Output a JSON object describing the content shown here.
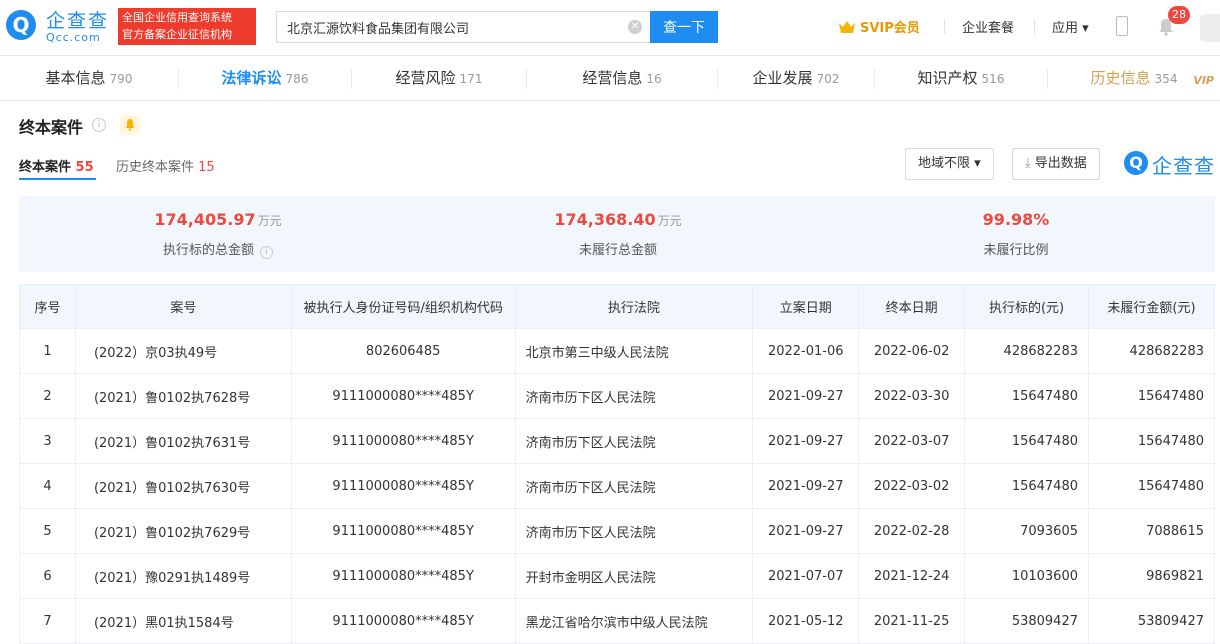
{
  "header": {
    "logo_text": "企查查",
    "logo_sub": "Qcc.com",
    "badge_line1": "全国企业信用查询系统",
    "badge_line2": "官方备案企业征信机构",
    "search_value": "北京汇源饮料食品集团有限公司",
    "search_button": "查一下",
    "svip": "SVIP会员",
    "nav_package": "企业套餐",
    "nav_apps": "应用 ▾",
    "notif_count": "28"
  },
  "tabs": [
    {
      "label": "基本信息",
      "count": "790"
    },
    {
      "label": "法律诉讼",
      "count": "786"
    },
    {
      "label": "经营风险",
      "count": "171"
    },
    {
      "label": "经营信息",
      "count": "16"
    },
    {
      "label": "企业发展",
      "count": "702"
    },
    {
      "label": "知识产权",
      "count": "516"
    },
    {
      "label": "历史信息",
      "count": "354",
      "tag": "VIP"
    }
  ],
  "section": {
    "title": "终本案件",
    "subtab_active_label": "终本案件",
    "subtab_active_count": "55",
    "subtab_other_label": "历史终本案件",
    "subtab_other_count": "15",
    "region_filter": "地域不限 ▾",
    "export_label": "导出数据",
    "brand_text": "企查查"
  },
  "summary": [
    {
      "value": "174,405.97",
      "unit": "万元",
      "label": "执行标的总金额"
    },
    {
      "value": "174,368.40",
      "unit": "万元",
      "label": "未履行总金额"
    },
    {
      "value": "99.98%",
      "unit": "",
      "label": "未履行比例"
    }
  ],
  "table": {
    "headers": [
      "序号",
      "案号",
      "被执行人身份证号码/组织机构代码",
      "执行法院",
      "立案日期",
      "终本日期",
      "执行标的(元)",
      "未履行金额(元)"
    ],
    "rows": [
      [
        "1",
        "(2022）京03执49号",
        "802606485",
        "北京市第三中级人民法院",
        "2022-01-06",
        "2022-06-02",
        "428682283",
        "428682283"
      ],
      [
        "2",
        "(2021）鲁0102执7628号",
        "9111000080****485Y",
        "济南市历下区人民法院",
        "2021-09-27",
        "2022-03-30",
        "15647480",
        "15647480"
      ],
      [
        "3",
        "(2021）鲁0102执7631号",
        "9111000080****485Y",
        "济南市历下区人民法院",
        "2021-09-27",
        "2022-03-07",
        "15647480",
        "15647480"
      ],
      [
        "4",
        "(2021）鲁0102执7630号",
        "9111000080****485Y",
        "济南市历下区人民法院",
        "2021-09-27",
        "2022-03-02",
        "15647480",
        "15647480"
      ],
      [
        "5",
        "(2021）鲁0102执7629号",
        "9111000080****485Y",
        "济南市历下区人民法院",
        "2021-09-27",
        "2022-02-28",
        "7093605",
        "7088615"
      ],
      [
        "6",
        "(2021）豫0291执1489号",
        "9111000080****485Y",
        "开封市金明区人民法院",
        "2021-07-07",
        "2021-12-24",
        "10103600",
        "9869821"
      ],
      [
        "7",
        "(2021）黑01执1584号",
        "9111000080****485Y",
        "黑龙江省哈尔滨市中级人民法院",
        "2021-05-12",
        "2021-11-25",
        "53809427",
        "53809427"
      ]
    ]
  }
}
